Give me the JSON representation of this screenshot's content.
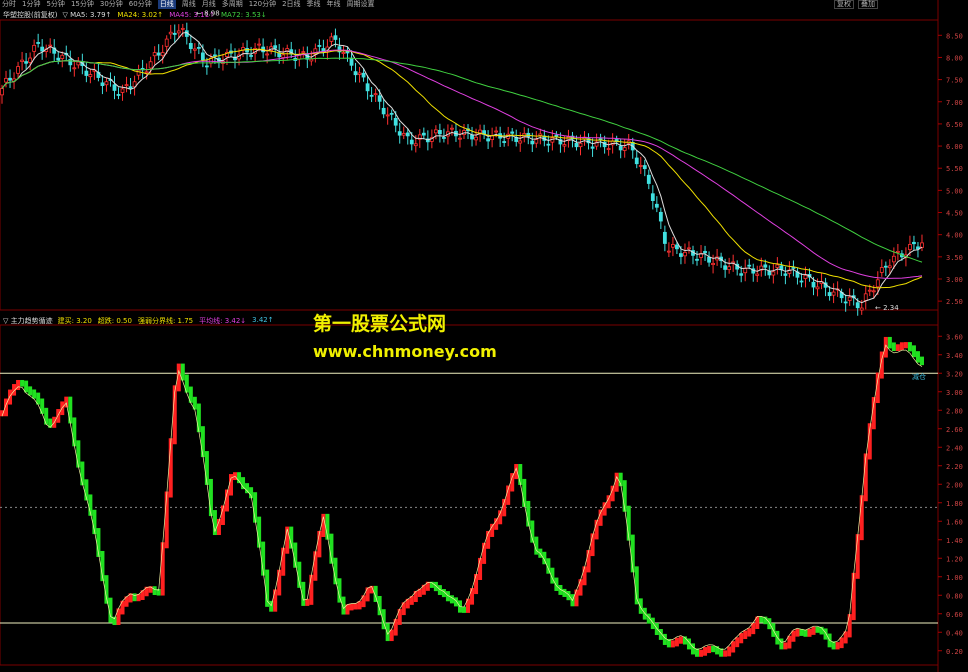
{
  "toolbar": {
    "items": [
      "分时",
      "1分钟",
      "5分钟",
      "15分钟",
      "30分钟",
      "60分钟",
      "日线",
      "周线",
      "月线",
      "多周期",
      "120分钟",
      "2日线",
      "季线",
      "年线",
      "周期设置"
    ],
    "active_index": 6,
    "right_buttons": [
      "复权",
      "叠加"
    ]
  },
  "main_panel": {
    "stock_name": "华塑控股(前复权)",
    "indicators": [
      {
        "text": "▽ MA5: 3.79↑",
        "color": "#dddddd"
      },
      {
        "text": "MA24: 3.02↑",
        "color": "#f0e000"
      },
      {
        "text": "MA45: 3.11↑",
        "color": "#e040e0"
      },
      {
        "text": "MA72: 3.53↓",
        "color": "#40d040"
      }
    ],
    "high_label": "8.98",
    "low_label": "2.34",
    "y_ticks": [
      "8.50",
      "8.00",
      "7.50",
      "7.00",
      "6.50",
      "6.00",
      "5.50",
      "5.00",
      "4.50",
      "4.00",
      "3.50",
      "3.00",
      "2.50"
    ],
    "y_range": [
      2.3,
      8.8
    ]
  },
  "sub_panel": {
    "name": "▽ 主力趋势循迹",
    "indicators": [
      {
        "text": "建买: 3.20",
        "color": "#f0e000"
      },
      {
        "text": "超跌: 0.50",
        "color": "#f0e000"
      },
      {
        "text": "强弱分界线: 1.75",
        "color": "#f0e000"
      },
      {
        "text": "平均线: 3.42↓",
        "color": "#e040e0"
      },
      {
        "text": "3.42↑",
        "color": "#40c0e0"
      }
    ],
    "y_ticks": [
      "3.60",
      "3.40",
      "3.20",
      "3.00",
      "2.80",
      "2.60",
      "2.40",
      "2.20",
      "2.00",
      "1.80",
      "1.60",
      "1.40",
      "1.20",
      "1.00",
      "0.80",
      "0.60",
      "0.40",
      "0.20"
    ],
    "y_range": [
      0.1,
      3.7
    ],
    "level_buy": 3.2,
    "level_oversold": 0.5,
    "level_mid": 1.75,
    "tag_hold": "减仓"
  },
  "watermark": {
    "title": "第一股票公式网",
    "url": "www.chnmoney.com"
  }
}
